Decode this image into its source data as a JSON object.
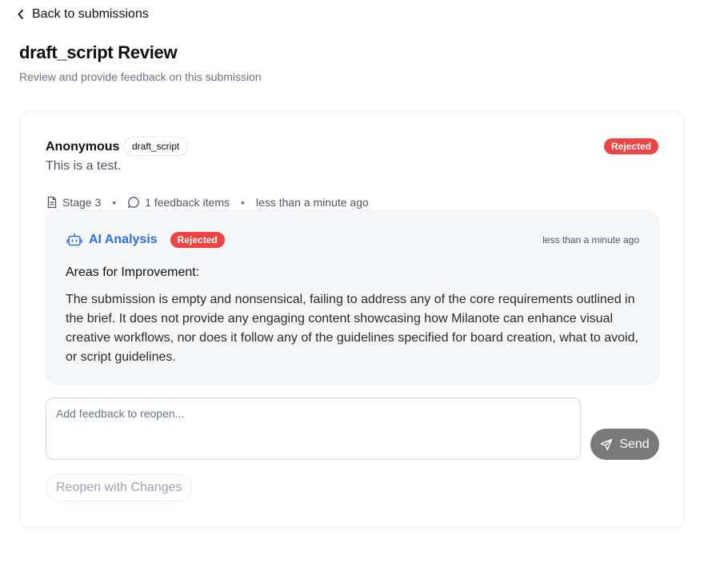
{
  "nav": {
    "back_label": "Back to submissions"
  },
  "header": {
    "title": "draft_script Review",
    "subtitle": "Review and provide feedback on this submission"
  },
  "submission": {
    "author": "Anonymous",
    "tag": "draft_script",
    "status": "Rejected",
    "text": "This is a test.",
    "meta": {
      "stage": "Stage 3",
      "feedback_count": "1 feedback items",
      "time": "less than a minute ago"
    }
  },
  "ai_analysis": {
    "title": "AI Analysis",
    "status": "Rejected",
    "time": "less than a minute ago",
    "heading": "Areas for Improvement:",
    "content": "The submission is empty and nonsensical, failing to address any of the core requirements outlined in the brief. It does not provide any engaging content showcasing how Milanote can enhance visual creative workflows, nor does it follow any of the guidelines specified for board creation, what to avoid, or script guidelines."
  },
  "feedback": {
    "placeholder": "Add feedback to reopen...",
    "value": "",
    "send_label": "Send",
    "reopen_label": "Reopen with Changes"
  },
  "colors": {
    "rejected": "#ef4444",
    "ai_accent": "#2f6fe4",
    "send_disabled": "#7a7a7a"
  },
  "icons": {
    "back": "chevron-left-icon",
    "stage": "document-icon",
    "feedback": "message-circle-icon",
    "ai": "bot-icon",
    "send": "send-icon"
  }
}
